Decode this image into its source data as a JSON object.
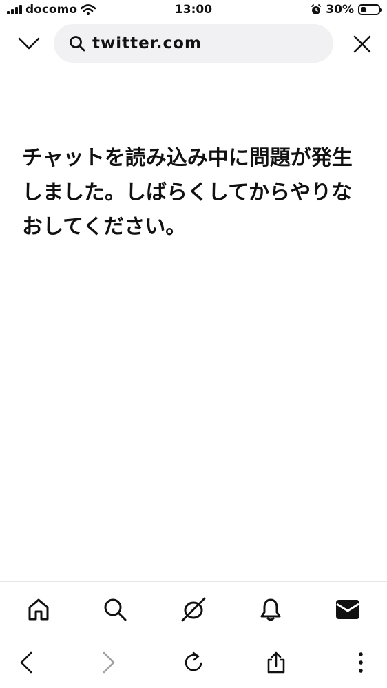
{
  "status_bar": {
    "carrier": "docomo",
    "time": "13:00",
    "battery": "30%",
    "battery_level": 0.3,
    "icons": [
      "signal-icon",
      "wifi-icon",
      "alarm-icon",
      "battery-icon"
    ]
  },
  "url_bar": {
    "url": "twitter.com",
    "icons": [
      "chevron-down-icon",
      "search-icon",
      "close-icon"
    ]
  },
  "main": {
    "error_message": "チャットを読み込み中に問題が発生しました。しばらくしてからやりなおしてください。"
  },
  "tab_bar": {
    "icons": [
      "home-icon",
      "search-icon",
      "spaces-icon",
      "bell-icon",
      "mail-icon"
    ],
    "colors": {
      "icon": "#111111"
    }
  },
  "browser_bar": {
    "icons": [
      "back-icon",
      "forward-icon",
      "reload-icon",
      "share-icon",
      "more-icon"
    ],
    "colors": {
      "forward_disabled": "#a0a0a0"
    }
  }
}
